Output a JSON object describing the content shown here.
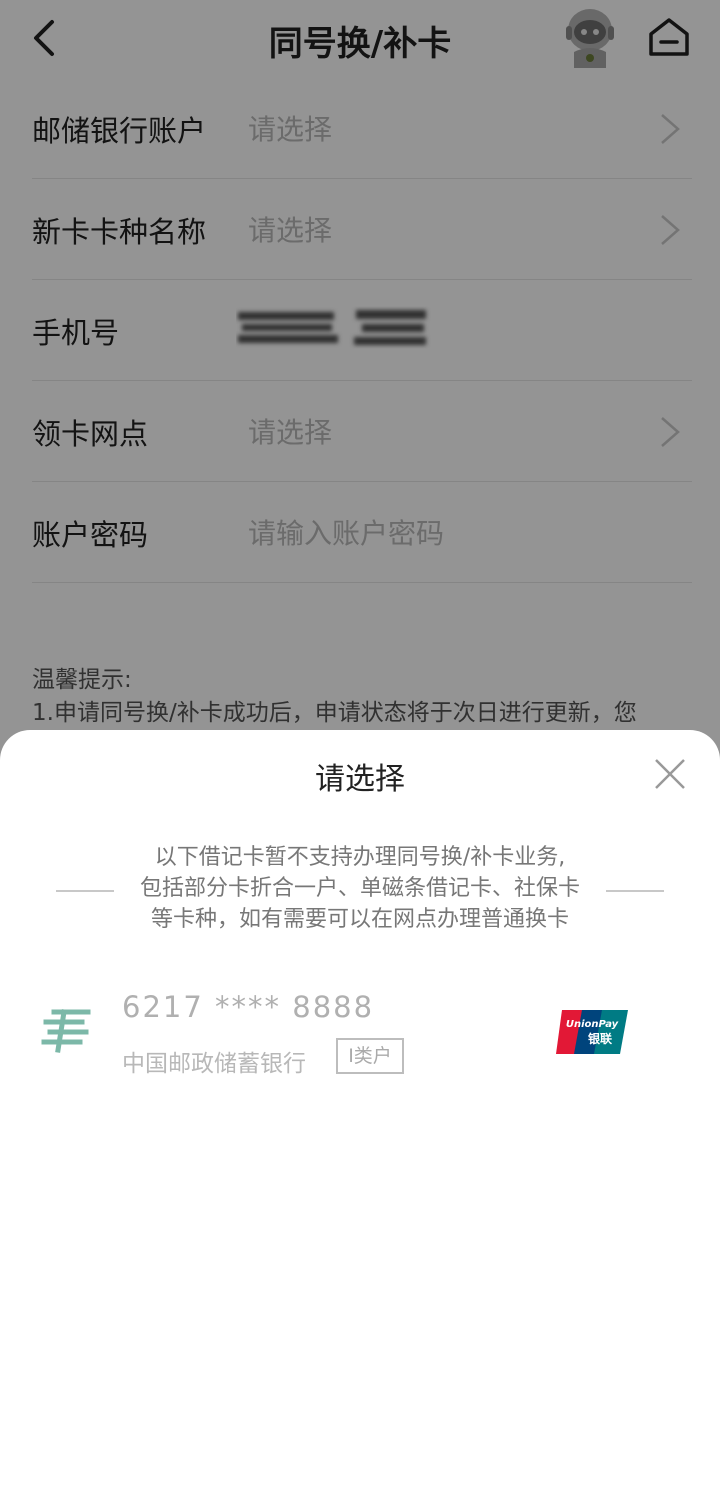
{
  "header": {
    "title": "同号换/补卡",
    "back_icon": "back-chevron-icon",
    "assistant_icon": "robot-assistant-icon",
    "home_icon": "home-icon"
  },
  "form": {
    "rows": [
      {
        "label": "邮储银行账户",
        "value": "请选择",
        "has_chevron": true
      },
      {
        "label": "新卡卡种名称",
        "value": "请选择",
        "has_chevron": true
      },
      {
        "label": "手机号",
        "value": "",
        "blurred": true
      },
      {
        "label": "领卡网点",
        "value": "请选择",
        "has_chevron": true
      },
      {
        "label": "账户密码",
        "value": "请输入账户密码",
        "has_chevron": false
      }
    ]
  },
  "tips": {
    "heading": "温馨提示:",
    "line1": "1.申请同号换/补卡成功后，申请状态将于次日进行更新，您"
  },
  "sheet": {
    "title": "请选择",
    "notice": [
      "以下借记卡暂不支持办理同号换/补卡业务,",
      "包括部分卡折合一户、单磁条借记卡、社保卡",
      "等卡种，如有需要可以在网点办理普通换卡"
    ],
    "card": {
      "number": "6217 **** 8888",
      "bank": "中国邮政储蓄银行",
      "class": "I类户",
      "network_logo": "UnionPay银联"
    }
  },
  "colors": {
    "overlay": "#000000",
    "unionpay_red": "#e21836",
    "unionpay_blue": "#00447c",
    "unionpay_teal": "#007b84",
    "postal_green": "#7cb8a8"
  }
}
